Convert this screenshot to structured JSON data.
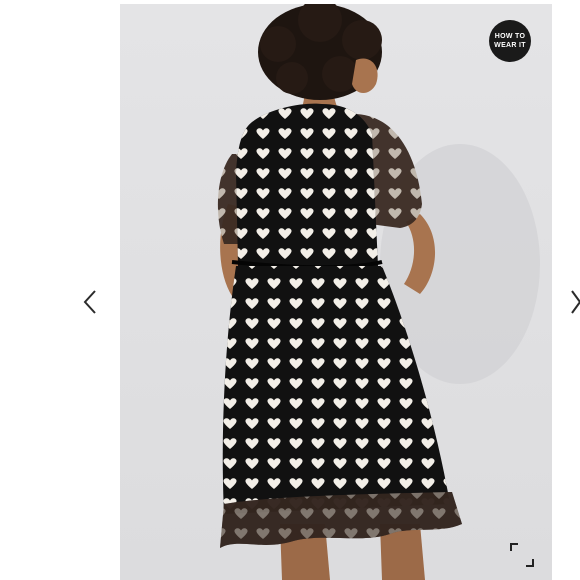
{
  "badge": {
    "line1": "HOW TO",
    "line2": "WEAR IT"
  },
  "icons": {
    "prev": "chevron-left-icon",
    "next": "chevron-right-icon",
    "expand": "expand-icon"
  },
  "colors": {
    "badge_bg": "#1a1a1a",
    "dress": "#111111",
    "hearts": "#f3efe8",
    "skin": "#b07a55",
    "backdrop": "#dedee0"
  }
}
